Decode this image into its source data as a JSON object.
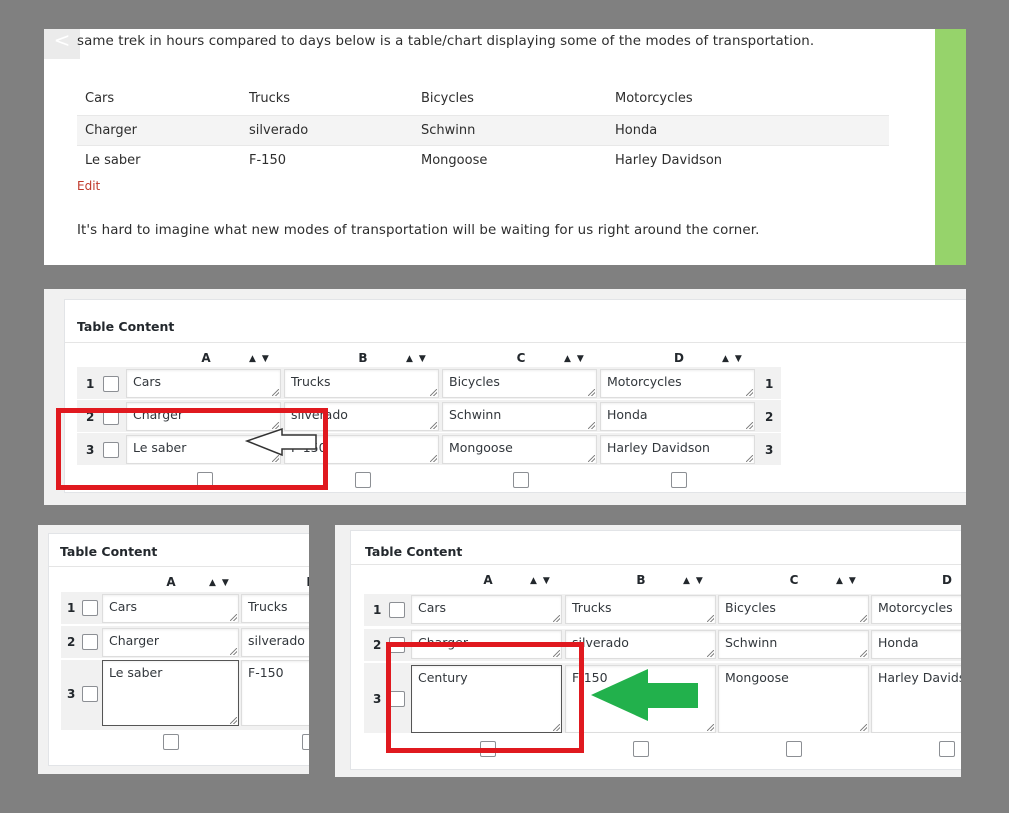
{
  "preview": {
    "back_glyph": "<",
    "intro_text": "same trek in hours compared to days below is a table/chart displaying some of the modes of transportation.",
    "table": [
      [
        "Cars",
        "Trucks",
        "Bicycles",
        "Motorcycles"
      ],
      [
        "Charger",
        "silverado",
        "Schwinn",
        "Honda"
      ],
      [
        "Le saber",
        "F-150",
        "Mongoose",
        "Harley Davidson"
      ]
    ],
    "edit_link": "Edit",
    "outro_text": "It's hard to imagine what new modes of transportation will be waiting for us right around the corner."
  },
  "editor_main": {
    "title": "Table Content",
    "columns": [
      "A",
      "B",
      "C",
      "D"
    ],
    "sort_arrows": "▲▼",
    "row_numbers": [
      "1",
      "2",
      "3"
    ],
    "cells": [
      [
        "Cars",
        "Trucks",
        "Bicycles",
        "Motorcycles"
      ],
      [
        "Charger",
        "silverado",
        "Schwinn",
        "Honda"
      ],
      [
        "Le saber",
        "F-150",
        "Mongoose",
        "Harley Davidson"
      ]
    ]
  },
  "editor_small": {
    "title": "Table Content",
    "columns": [
      "A",
      "B"
    ],
    "sort_arrows": "▲▼",
    "row_numbers": [
      "1",
      "2",
      "3"
    ],
    "cells": [
      [
        "Cars",
        "Trucks"
      ],
      [
        "Charger",
        "silverado"
      ],
      [
        "Le saber",
        "F-150"
      ]
    ]
  },
  "editor_edited": {
    "title": "Table Content",
    "columns": [
      "A",
      "B",
      "C",
      "D"
    ],
    "sort_arrows": "▲▼",
    "row_numbers": [
      "1",
      "2",
      "3"
    ],
    "cells": [
      [
        "Cars",
        "Trucks",
        "Bicycles",
        "Motorcycles"
      ],
      [
        "Charger",
        "silverado",
        "Schwinn",
        "Honda"
      ],
      [
        "Century",
        "F-150",
        "Mongoose",
        "Harley Davidson"
      ]
    ]
  },
  "colors": {
    "page_bg": "#808080",
    "accent_green_bar": "#96d36b",
    "highlight_red": "#e0191f",
    "arrow_green": "#22b14c",
    "edit_link": "#c0392b"
  }
}
